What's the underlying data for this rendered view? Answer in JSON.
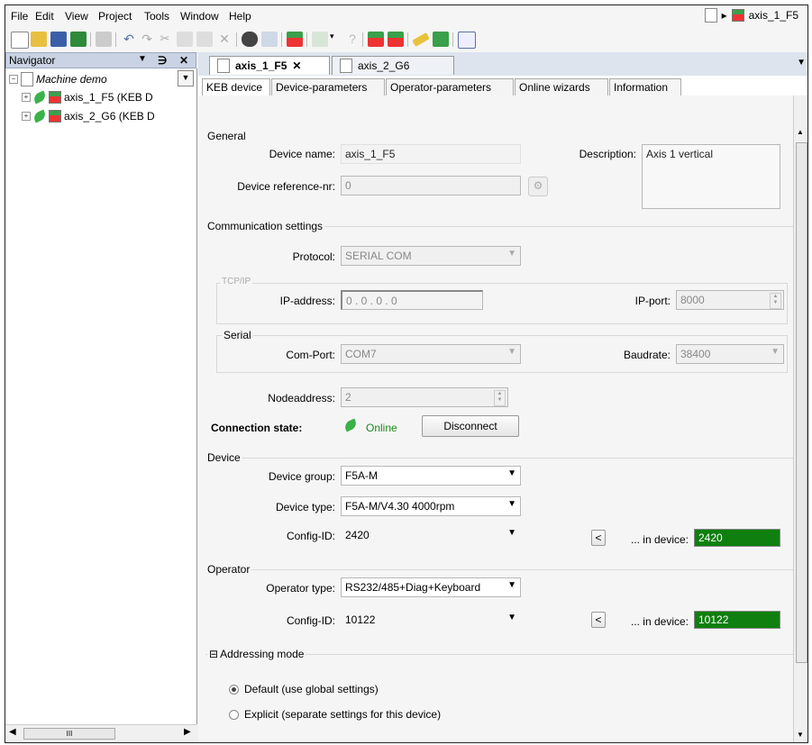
{
  "menu": [
    "File",
    "Edit",
    "View",
    "Project",
    "Tools",
    "Window",
    "Help"
  ],
  "breadcrumb": {
    "current": "axis_1_F5"
  },
  "navigator": {
    "title": "Navigator",
    "pin": "↓ →",
    "close": "✕",
    "root": "Machine demo",
    "items": [
      "axis_1_F5 (KEB D",
      "axis_2_G6 (KEB D"
    ]
  },
  "doc_tabs": [
    {
      "label": "axis_1_F5",
      "close": "✕"
    },
    {
      "label": "axis_2_G6"
    }
  ],
  "inner_tabs": [
    "KEB device",
    "Device-parameters",
    "Operator-parameters",
    "Online wizards",
    "Information"
  ],
  "general": {
    "title": "General",
    "device_name_label": "Device name:",
    "device_name": "axis_1_F5",
    "description_label": "Description:",
    "description": "Axis 1 vertical",
    "ref_label": "Device reference-nr:",
    "ref_value": "0"
  },
  "comm": {
    "title": "Communication settings",
    "protocol_label": "Protocol:",
    "protocol": "SERIAL COM",
    "tcp_title": "TCP/IP",
    "ip_label": "IP-address:",
    "ip_value": "0 . 0 . 0 . 0",
    "port_label": "IP-port:",
    "port_value": "8000",
    "serial_title": "Serial",
    "comport_label": "Com-Port:",
    "comport": "COM7",
    "baud_label": "Baudrate:",
    "baud": "38400",
    "node_label": "Nodeaddress:",
    "node_value": "2",
    "state_label": "Connection state:",
    "state_value": "Online",
    "disconnect": "Disconnect"
  },
  "device": {
    "title": "Device",
    "group_label": "Device group:",
    "group": "F5A-M",
    "type_label": "Device type:",
    "type": "F5A-M/V4.30 4000rpm",
    "config_label": "Config-ID:",
    "config": "2420",
    "copy_btn": "<",
    "in_device_label": "... in device:",
    "in_device": "2420"
  },
  "operator": {
    "title": "Operator",
    "type_label": "Operator type:",
    "type": "RS232/485+Diag+Keyboard",
    "config_label": "Config-ID:",
    "config": "10122",
    "copy_btn": "<",
    "in_device_label": "... in device:",
    "in_device": "10122"
  },
  "addressing": {
    "title": "Addressing mode",
    "collapse": "⊟",
    "opt_default": "Default (use global settings)",
    "opt_explicit": "Explicit (separate settings for this device)"
  },
  "scroll": {
    "hthumb": "III"
  },
  "colors": {
    "accent_green": "#0f7f0f",
    "nav_head": "#c9d3e3"
  }
}
